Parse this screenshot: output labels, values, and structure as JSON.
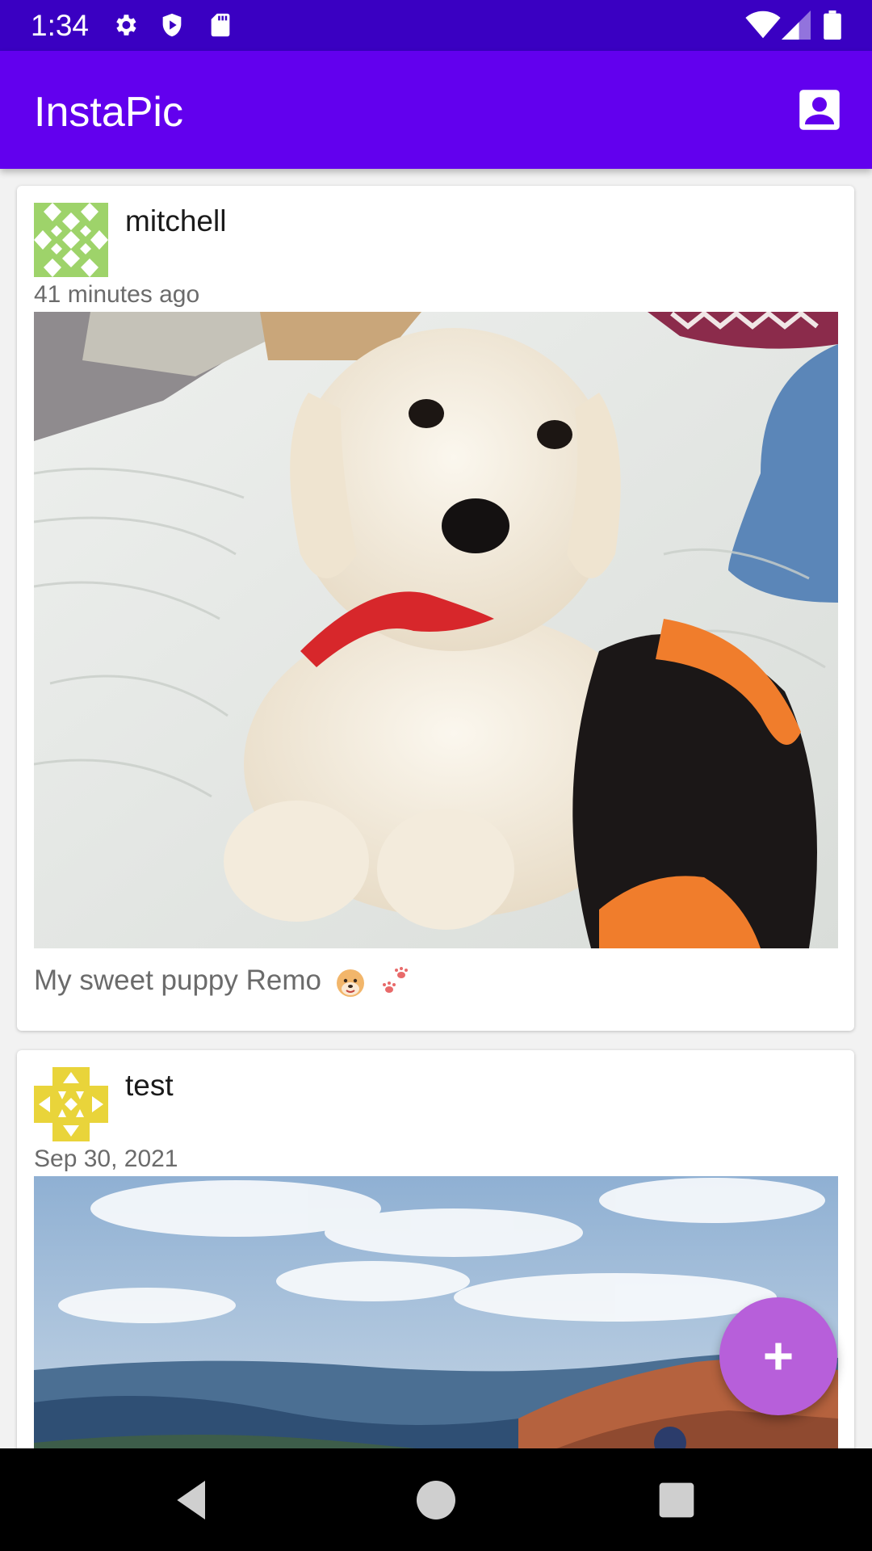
{
  "status_bar": {
    "time": "1:34",
    "icons": [
      "gear-icon",
      "shield-icon",
      "sd-card-icon",
      "wifi-icon",
      "signal-icon",
      "battery-icon"
    ]
  },
  "app_bar": {
    "title": "InstaPic",
    "action_icon": "account-box-icon"
  },
  "posts": [
    {
      "username": "mitchell",
      "timestamp": "41 minutes ago",
      "caption": "My sweet puppy Remo",
      "caption_emojis": [
        "dog-face-emoji",
        "paw-prints-emoji"
      ],
      "avatar_color": "#9ed36a",
      "image": "white-puppy-photo"
    },
    {
      "username": "test",
      "timestamp": "Sep 30, 2021",
      "avatar_color": "#e9d43a",
      "image": "mountain-bikers-photo"
    }
  ],
  "fab": {
    "icon": "plus-icon",
    "color": "#b75fda"
  },
  "nav_bar": {
    "buttons": [
      "back-button",
      "home-button",
      "recents-button"
    ]
  },
  "colors": {
    "primary": "#6200ee",
    "primary_dark": "#3a00c2"
  }
}
